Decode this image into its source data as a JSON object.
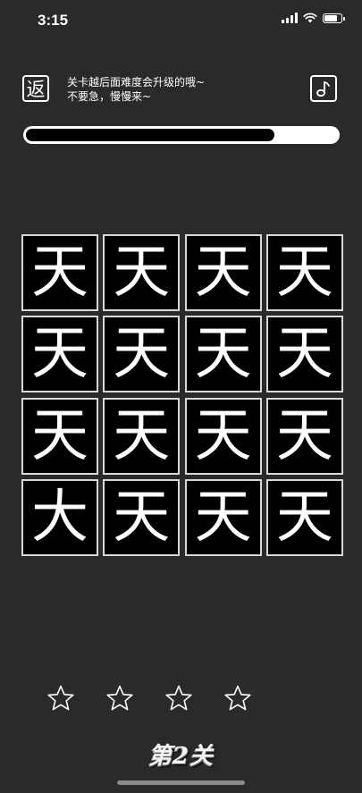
{
  "status_bar": {
    "time": "3:15",
    "battery_level": 0.85
  },
  "header": {
    "back_label": "返",
    "music_icon": "music-note-icon",
    "hint_line1": "关卡越后面难度会升级的哦~",
    "hint_line2": "不要急，慢慢来~"
  },
  "progress": {
    "value": 0.8
  },
  "grid": {
    "tiles": [
      "天",
      "天",
      "天",
      "天",
      "天",
      "天",
      "天",
      "天",
      "天",
      "天",
      "天",
      "天",
      "大",
      "天",
      "天",
      "天"
    ]
  },
  "stars": {
    "filled": 0,
    "total": 4
  },
  "level": {
    "label": "第2关"
  },
  "colors": {
    "background": "#2a2a2c",
    "tile_background": "#000000",
    "tile_border": "#d8d8d8",
    "text": "#ffffff"
  }
}
